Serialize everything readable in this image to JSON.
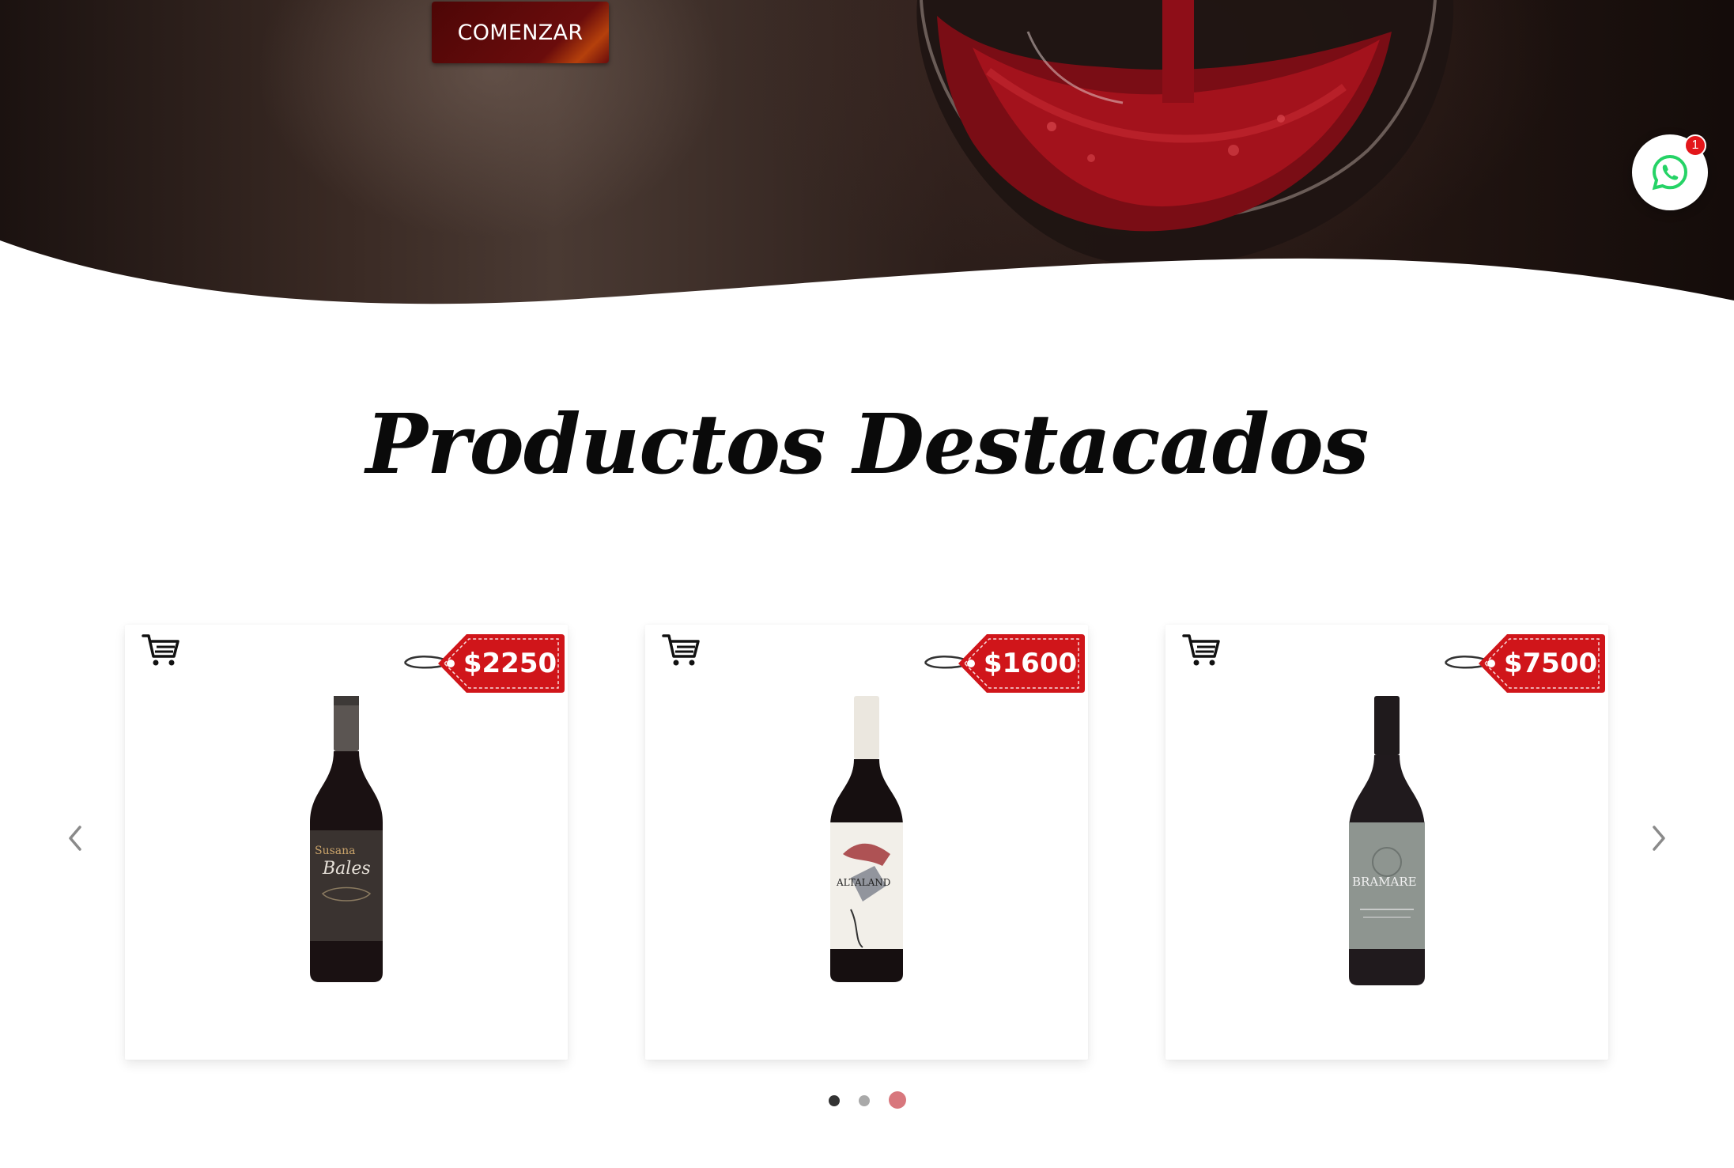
{
  "hero": {
    "cta_label": "COMENZAR"
  },
  "whatsapp": {
    "icon": "whatsapp-icon",
    "badge_count": "1",
    "brand_color": "#25D366"
  },
  "featured": {
    "title": "Productos Destacados",
    "products": [
      {
        "price": "$2250",
        "label_brand": "Bales",
        "label_line": "Susana"
      },
      {
        "price": "$1600",
        "label_brand": "ALTALAND",
        "label_line": ""
      },
      {
        "price": "$7500",
        "label_brand": "BRAMARE",
        "label_line": ""
      }
    ],
    "carousel": {
      "active_dot": 3,
      "dot_count": 3
    }
  },
  "colors": {
    "accent_red": "#d0151a",
    "wine_dark": "#5a0a0a",
    "active_dot": "#d8777d"
  }
}
